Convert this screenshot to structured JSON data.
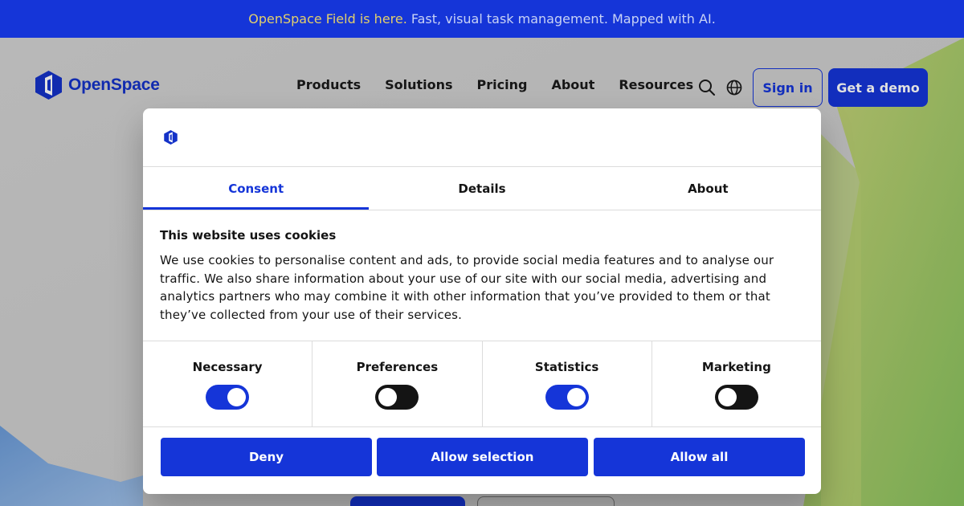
{
  "announcement": {
    "highlight": "OpenSpace Field is here.",
    "text": "Fast, visual task management. Mapped with AI."
  },
  "header": {
    "brand": "OpenSpace",
    "nav": [
      "Products",
      "Solutions",
      "Pricing",
      "About",
      "Resources"
    ],
    "search_icon": "search-icon",
    "language_icon": "globe-icon",
    "sign_in": "Sign in",
    "get_demo": "Get a demo"
  },
  "consent_dialog": {
    "tabs": [
      {
        "label": "Consent",
        "active": true
      },
      {
        "label": "Details",
        "active": false
      },
      {
        "label": "About",
        "active": false
      }
    ],
    "title": "This website uses cookies",
    "body": "We use cookies to personalise content and ads, to provide social media features and to analyse our traffic. We also share information about your use of our site with our social media, advertising and analytics partners who may combine it with other information that you’ve provided to them or that they’ve collected from your use of their services.",
    "categories": [
      {
        "label": "Necessary",
        "enabled": true
      },
      {
        "label": "Preferences",
        "enabled": false
      },
      {
        "label": "Statistics",
        "enabled": true
      },
      {
        "label": "Marketing",
        "enabled": false
      }
    ],
    "buttons": {
      "deny": "Deny",
      "allow_selection": "Allow selection",
      "allow_all": "Allow all"
    }
  },
  "colors": {
    "brand_blue": "#1535d8",
    "announcement_highlight": "#e2cf6c",
    "toggle_off": "#141414"
  }
}
